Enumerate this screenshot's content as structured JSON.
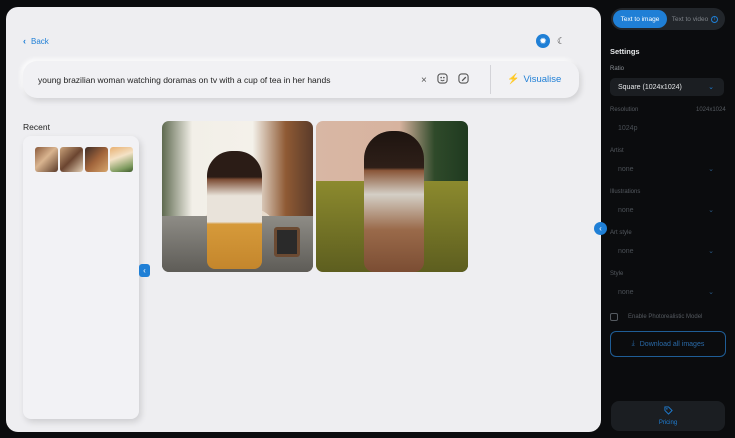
{
  "header": {
    "back_label": "Back",
    "back_icon": "chevron-left-icon",
    "theme": {
      "light_icon": "sun-icon",
      "dark_icon": "moon-icon",
      "selected": "light"
    }
  },
  "prompt": {
    "value": "young brazilian woman watching doramas on tv with a cup of tea in her hands",
    "clear_glyph": "×",
    "visualise_label": "Visualise"
  },
  "recent": {
    "label": "Recent",
    "thumbnails": [
      "recent-thumbnail-1",
      "recent-thumbnail-2",
      "recent-thumbnail-3",
      "recent-thumbnail-4"
    ]
  },
  "results": [
    "generated-image-1",
    "generated-image-2"
  ],
  "sidebar": {
    "modes": [
      {
        "label": "Text to image",
        "active": true
      },
      {
        "label": "Text to video",
        "active": false,
        "info_glyph": "i"
      }
    ],
    "settings_title": "Settings",
    "ratio": {
      "label": "Ratio",
      "value": "Square (1024x1024)"
    },
    "resolution": {
      "label": "Resolution",
      "display": "1024x1024",
      "value": "1024p"
    },
    "artist": {
      "label": "Artist",
      "value": "none"
    },
    "illustrations": {
      "label": "Illustrations",
      "value": "none"
    },
    "art_style": {
      "label": "Art style",
      "value": "none"
    },
    "style": {
      "label": "Style",
      "value": "none"
    },
    "photorealistic": {
      "label": "Enable Photorealistic Model",
      "checked": false
    },
    "download_label": "Download all images",
    "pricing_label": "Pricing"
  },
  "colors": {
    "accent": "#1f7fd6",
    "sidebar_bg": "#0b0c0e",
    "main_bg": "#eeeef1"
  }
}
